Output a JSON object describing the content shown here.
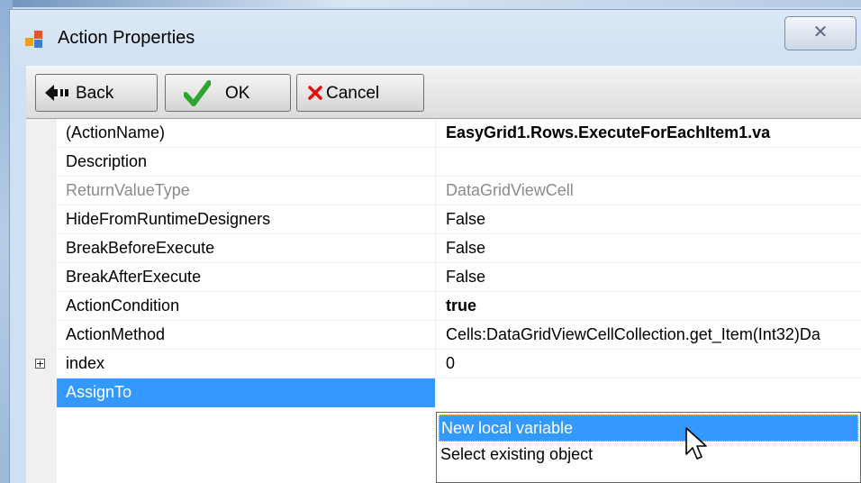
{
  "window": {
    "title": "Action Properties",
    "close_glyph": "✕"
  },
  "toolbar": {
    "back_label": "Back",
    "ok_label": "OK",
    "cancel_label": "Cancel"
  },
  "icons": {
    "app": "app-icon",
    "back": "back-arrow-icon",
    "ok": "green-check-icon",
    "cancel": "red-x-icon",
    "expand": "plus-box-icon",
    "dropdown": "chevron-down-icon",
    "cursor": "mouse-pointer-icon"
  },
  "colors": {
    "selection": "#3399ff",
    "ok_check": "#2fa52f",
    "cancel_x": "#e01010"
  },
  "properties": [
    {
      "name": "(ActionName)",
      "value": "EasyGrid1.Rows.ExecuteForEachItem1.va"
    },
    {
      "name": "Description",
      "value": ""
    },
    {
      "name": "ReturnValueType",
      "value": "DataGridViewCell"
    },
    {
      "name": "HideFromRuntimeDesigners",
      "value": "False"
    },
    {
      "name": "BreakBeforeExecute",
      "value": "False"
    },
    {
      "name": "BreakAfterExecute",
      "value": "False"
    },
    {
      "name": "ActionCondition",
      "value": "true"
    },
    {
      "name": "ActionMethod",
      "value": "Cells:DataGridViewCellCollection.get_Item(Int32)Da"
    },
    {
      "name": "index",
      "value": "0"
    },
    {
      "name": "AssignTo",
      "value": ""
    }
  ],
  "dropdown": {
    "options": [
      "New local variable",
      "Select existing object"
    ],
    "highlighted": "New local variable"
  }
}
